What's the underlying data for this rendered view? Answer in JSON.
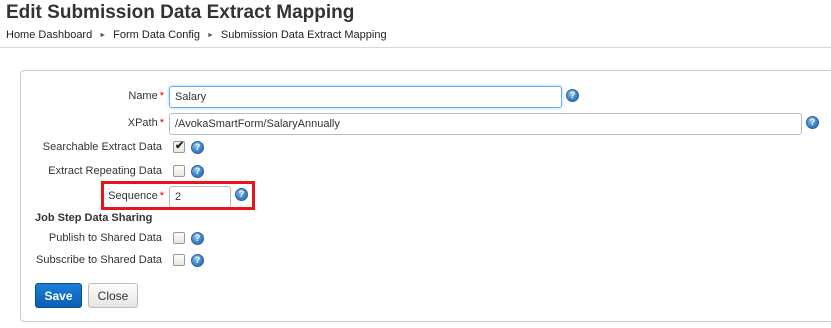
{
  "page": {
    "title": "Edit Submission Data Extract Mapping",
    "breadcrumb": [
      "Home Dashboard",
      "Form Data Config",
      "Submission Data Extract Mapping"
    ],
    "breadcrumb_separator": "►"
  },
  "form": {
    "name": {
      "label": "Name",
      "required_mark": "*",
      "value": "Salary"
    },
    "xpath": {
      "label": "XPath",
      "required_mark": "*",
      "value": "/AvokaSmartForm/SalaryAnnually"
    },
    "searchable_extract_data": {
      "label": "Searchable Extract Data",
      "checked": true
    },
    "extract_repeating_data": {
      "label": "Extract Repeating Data",
      "checked": false
    },
    "sequence": {
      "label": "Sequence",
      "required_mark": "*",
      "value": "2"
    },
    "job_step_section": {
      "heading": "Job Step Data Sharing"
    },
    "publish_to_shared_data": {
      "label": "Publish to Shared Data",
      "checked": false
    },
    "subscribe_to_shared_data": {
      "label": "Subscribe to Shared Data",
      "checked": false
    },
    "help_icon_glyph": "?",
    "check_glyph": "✔"
  },
  "buttons": {
    "save": "Save",
    "close": "Close"
  },
  "colors": {
    "highlight": "#e8141c",
    "primary": "#0b5fb2",
    "required": "#dd0000"
  }
}
